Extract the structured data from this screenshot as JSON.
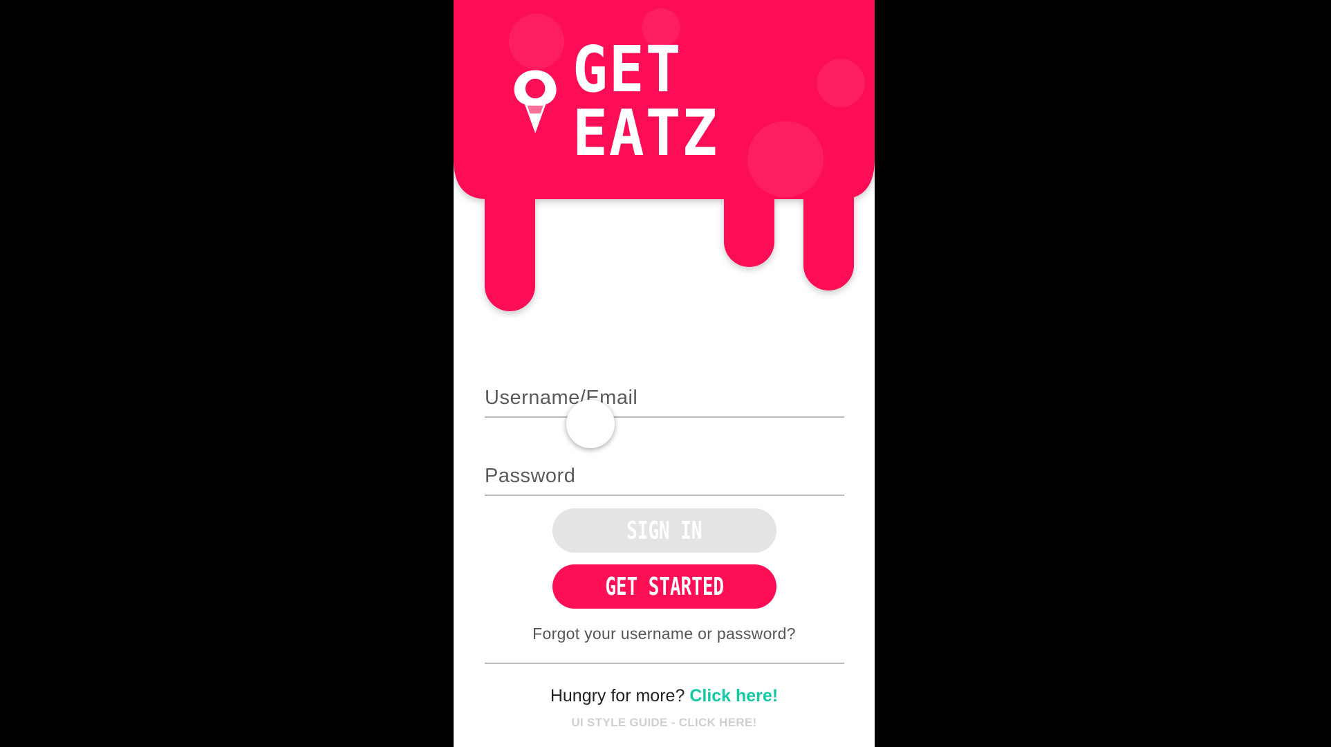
{
  "brand": {
    "name": "GET EATZ",
    "color": "#fc0f54",
    "logo_icon": "ice-cream-pin-icon"
  },
  "login": {
    "username_placeholder": "Username/Email",
    "password_placeholder": "Password",
    "signin_label": "SIGN IN",
    "get_started_label": "GET STARTED",
    "forgot_text": "Forgot your username or password?"
  },
  "footer": {
    "hungry_text": "Hungry for more?",
    "click_here": "Click here!",
    "style_guide": "UI STYLE GUIDE - CLICK HERE!",
    "link_color": "#13c9a4"
  }
}
